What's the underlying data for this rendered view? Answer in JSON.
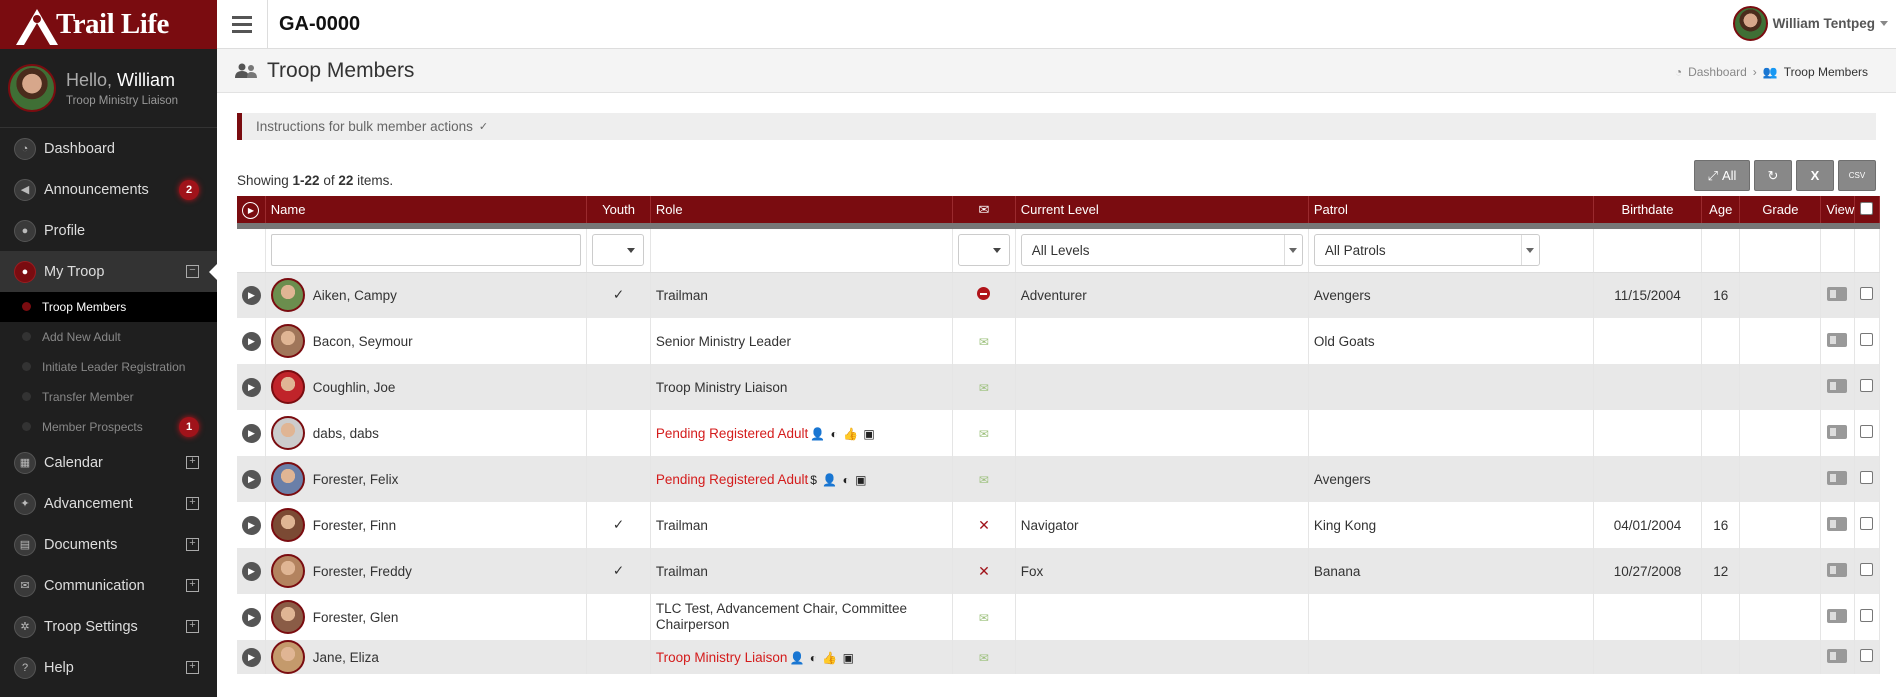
{
  "brand": {
    "logo_text": "Trail Life",
    "color": "#7a0c10"
  },
  "topbar": {
    "unit": "GA-0000",
    "user_name": "William Tentpeg"
  },
  "sidebar": {
    "hello": "Hello,",
    "first_name": "William",
    "role": "Troop Ministry Liaison",
    "items": [
      {
        "label": "Dashboard",
        "icon": "dashboard-icon",
        "glyph": "◔"
      },
      {
        "label": "Announcements",
        "icon": "megaphone-icon",
        "glyph": "◀",
        "badge": "2"
      },
      {
        "label": "Profile",
        "icon": "user-icon",
        "glyph": "●"
      },
      {
        "label": "My Troop",
        "icon": "troop-icon",
        "glyph": "●",
        "expand": "−"
      },
      {
        "label": "Calendar",
        "icon": "calendar-icon",
        "glyph": "▦",
        "expand": "+"
      },
      {
        "label": "Advancement",
        "icon": "hiker-icon",
        "glyph": "✦",
        "expand": "+"
      },
      {
        "label": "Documents",
        "icon": "document-icon",
        "glyph": "▤",
        "expand": "+"
      },
      {
        "label": "Communication",
        "icon": "envelope-icon",
        "glyph": "✉",
        "expand": "+"
      },
      {
        "label": "Troop Settings",
        "icon": "cogs-icon",
        "glyph": "✲",
        "expand": "+"
      },
      {
        "label": "Help",
        "icon": "help-icon",
        "glyph": "?",
        "expand": "+"
      }
    ],
    "subitems": [
      {
        "label": "Troop Members"
      },
      {
        "label": "Add New Adult"
      },
      {
        "label": "Initiate Leader Registration"
      },
      {
        "label": "Transfer Member"
      },
      {
        "label": "Member Prospects",
        "badge": "1"
      }
    ]
  },
  "page": {
    "title": "Troop Members",
    "breadcrumb": [
      "Dashboard",
      "Troop Members"
    ],
    "instructions": "Instructions for bulk member actions",
    "showing_prefix": "Showing ",
    "showing_range": "1-22",
    "showing_of": " of ",
    "showing_total": "22",
    "showing_suffix": " items."
  },
  "toolbar": {
    "expand_all": "All"
  },
  "table": {
    "columns": [
      "Name",
      "Youth",
      "Role",
      "Current Level",
      "Patrol",
      "Birthdate",
      "Age",
      "Grade",
      "View"
    ],
    "filters": {
      "level": "All Levels",
      "patrol": "All Patrols"
    },
    "rows": [
      {
        "name": "Aiken, Campy",
        "youth": "✓",
        "role": "Trailman",
        "pending": false,
        "roleicons": "",
        "mail": "no-entry",
        "level": "Adventurer",
        "patrol": "Avengers",
        "birthdate": "11/15/2004",
        "age": "16",
        "grade": "",
        "avatar": "#6b8e4e"
      },
      {
        "name": "Bacon, Seymour",
        "youth": "",
        "role": "Senior Ministry Leader",
        "pending": false,
        "roleicons": "",
        "mail": "ok",
        "level": "",
        "patrol": "Old Goats",
        "birthdate": "",
        "age": "",
        "grade": "",
        "avatar": "#a0765a"
      },
      {
        "name": "Coughlin, Joe",
        "youth": "",
        "role": "Troop Ministry Liaison",
        "pending": false,
        "roleicons": "",
        "mail": "ok",
        "level": "",
        "patrol": "",
        "birthdate": "",
        "age": "",
        "grade": "",
        "avatar": "#c0242a"
      },
      {
        "name": "dabs, dabs",
        "youth": "",
        "role": "Pending Registered Adult",
        "pending": true,
        "roleicons": "👤 ◐ 👍 ▣",
        "mail": "ok",
        "level": "",
        "patrol": "",
        "birthdate": "",
        "age": "",
        "grade": "",
        "avatar": "#cccccc"
      },
      {
        "name": "Forester, Felix",
        "youth": "",
        "role": "Pending Registered Adult",
        "pending": true,
        "roleicons": "$ 👤 ◐ ▣",
        "mail": "ok",
        "level": "",
        "patrol": "Avengers",
        "birthdate": "",
        "age": "",
        "grade": "",
        "avatar": "#6a7fa8"
      },
      {
        "name": "Forester, Finn",
        "youth": "✓",
        "role": "Trailman",
        "pending": false,
        "roleicons": "",
        "mail": "no",
        "level": "Navigator",
        "patrol": "King Kong",
        "birthdate": "04/01/2004",
        "age": "16",
        "grade": "",
        "avatar": "#7b4a34"
      },
      {
        "name": "Forester, Freddy",
        "youth": "✓",
        "role": "Trailman",
        "pending": false,
        "roleicons": "",
        "mail": "no",
        "level": "Fox",
        "patrol": "Banana",
        "birthdate": "10/27/2008",
        "age": "12",
        "grade": "",
        "avatar": "#b3835f"
      },
      {
        "name": "Forester, Glen",
        "youth": "",
        "role": "TLC Test, Advancement Chair, Committee Chairperson",
        "pending": false,
        "roleicons": "",
        "mail": "ok",
        "level": "",
        "patrol": "",
        "birthdate": "",
        "age": "",
        "grade": "",
        "avatar": "#8a5c46"
      },
      {
        "name": "Jane, Eliza",
        "youth": "",
        "role": "Troop Ministry Liaison",
        "pending": true,
        "roleicons": "👤 ◐ 👍 ▣",
        "mail": "ok",
        "level": "",
        "patrol": "",
        "birthdate": "",
        "age": "",
        "grade": "",
        "avatar": "#c49a6c"
      }
    ]
  }
}
